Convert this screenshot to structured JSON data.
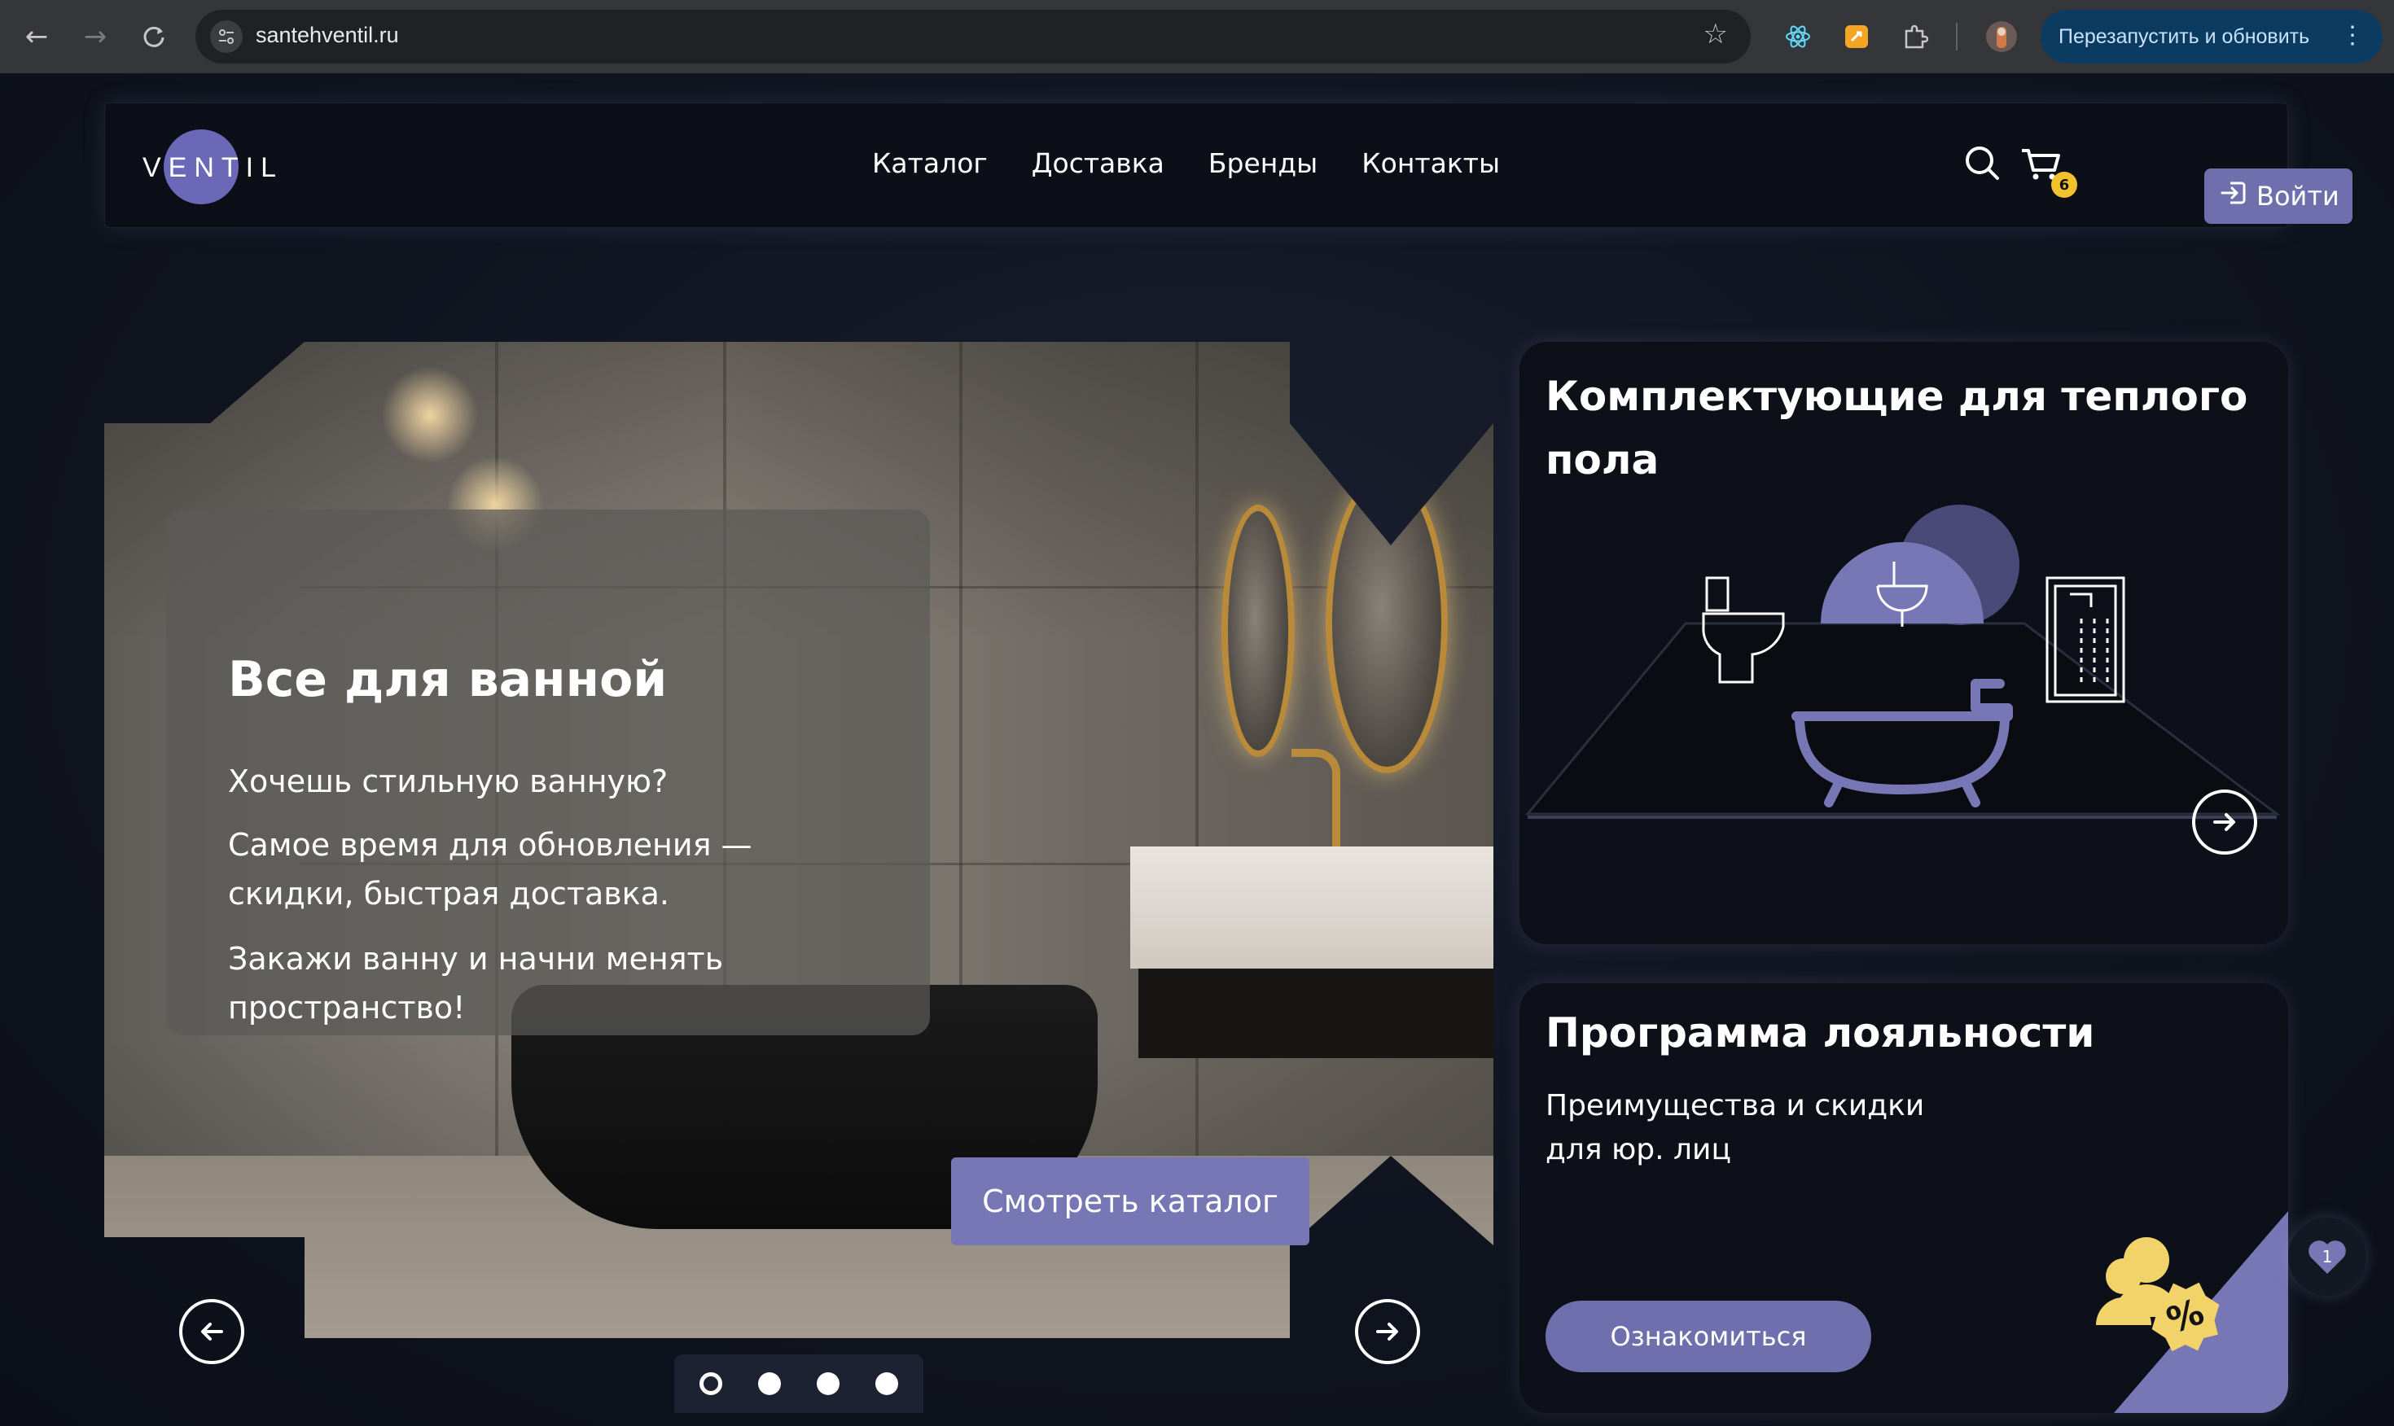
{
  "browser": {
    "url": "santehventil.ru",
    "restart_button": "Перезапустить и обновить"
  },
  "header": {
    "logo": "VENTIL",
    "nav": [
      "Каталог",
      "Доставка",
      "Бренды",
      "Контакты"
    ],
    "cart_count": "6",
    "login_label": "Войти"
  },
  "hero": {
    "title": "Все для ванной",
    "paragraphs": [
      "Хочешь стильную ванную?",
      "Самое время для обновления — скидки, быстрая доставка.",
      "Закажи ванну и начни менять пространство!"
    ],
    "cta": "Смотреть каталог",
    "slides_total": 4,
    "active_slide": 1
  },
  "cards": {
    "floor": {
      "title": "Комплектующие для теплого пола"
    },
    "loyalty": {
      "title": "Программа лояльности",
      "text_line1": "Преимущества и скидки",
      "text_line2": "для юр. лиц",
      "button": "Ознакомиться"
    }
  },
  "favorites": {
    "count": "1"
  },
  "colors": {
    "accent": "#6f6fae",
    "badge": "#f2c12e",
    "background": "#0d111a"
  },
  "icons": [
    "back-icon",
    "forward-icon",
    "reload-icon",
    "site-settings-icon",
    "bookmark-star-icon",
    "react-devtools-icon",
    "extension-icon",
    "puzzle-icon",
    "profile-avatar",
    "search-icon",
    "cart-icon",
    "login-icon",
    "arrow-left-icon",
    "arrow-right-icon",
    "heart-icon"
  ]
}
